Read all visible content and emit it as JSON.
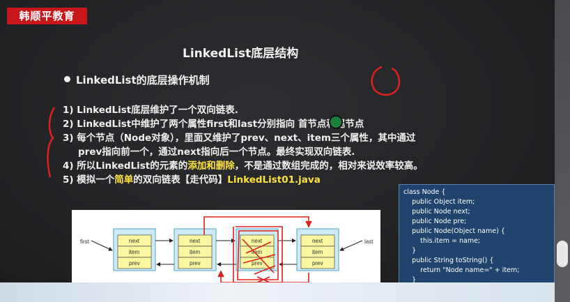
{
  "logo": "韩顺平教育",
  "title": "LinkedList底层结构",
  "bullet": "LinkedList的底层操作机制",
  "points": [
    {
      "text": "1) LinkedList底层维护了一个双向链表."
    },
    {
      "text": "2) LinkedList中维护了两个属性first和last分别指向 首节点和尾节点"
    },
    {
      "text": "3) 每个节点（Node对象），里面又维护了prev、next、item三个属性，其中通过"
    },
    {
      "text": "prev指向前一个，通过next指向后一个节点。最终实现双向链表."
    },
    {
      "pre": "4) 所以LinkedList的元素的",
      "hl": "添加和删除",
      "post": "，不是通过数组完成的，相对来说效率较高。"
    },
    {
      "pre": "5) 模拟一个",
      "hl": "简单",
      "mid": "的双向链表【走代码】",
      "hl2": "LinkedList01.java"
    }
  ],
  "diagram": {
    "first": "first",
    "last": "last",
    "nodes": [
      {
        "next": "next",
        "item": "item",
        "prev": "prev"
      },
      {
        "next": "next",
        "item": "item",
        "prev": "prev"
      },
      {
        "next": "next",
        "item": "item",
        "prev": "prev"
      },
      {
        "next": "next",
        "item": "item",
        "prev": "prev"
      }
    ]
  },
  "code": [
    "class Node {",
    "    public Object item;",
    "    public Node next;",
    "    public Node pre;",
    "    public Node(Object name) {",
    "        this.item = name;",
    "    }",
    "    public String toString() {",
    "        return \"Node name=\" + item;",
    "    }",
    "}"
  ],
  "colors": {
    "logo_bg": "#c8171b",
    "highlight": "#ffe23a",
    "annotation": "#e0201c",
    "node_fill": "#fbf7a0",
    "node_border": "#4da6c8",
    "code_bg": "#21446e"
  }
}
